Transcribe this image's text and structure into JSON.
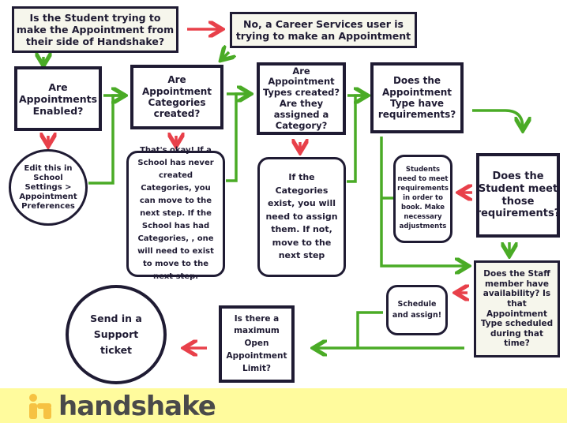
{
  "nodes": {
    "student_side": "Is the Student trying to make the Appointment from their side of Handshake?",
    "career_services": "No, a Career Services user is trying to make an Appointment",
    "appointments_enabled": "Are Appointments Enabled?",
    "edit_settings": "Edit this in School Settings > Appointment Preferences",
    "categories_created": "Are Appointment Categories created?",
    "categories_okay": "That's okay! If a School has never created Categories, you can move to the next step. If the School has had Categories, , one will need to exist to move to the next step.",
    "types_created": "Are Appointment Types created? Are they assigned a Category?",
    "assign_types": "If the Categories exist, you will need to assign them. If not, move to the next step",
    "type_requirements": "Does the Appointment Type have requirements?",
    "students_need": "Students need to meet requirements in order to book. Make necessary adjustments",
    "student_meet": "Does the Student meet those requirements?",
    "staff_availability": "Does the Staff member have availability? Is that Appointment Type scheduled during that time?",
    "schedule_assign": "Schedule and assign!",
    "max_limit": "Is there a maximum Open Appointment Limit?",
    "support_ticket": "Send in a Support ticket"
  },
  "footer": {
    "logo": "handshake"
  },
  "colors": {
    "yes_arrow": "#4aab26",
    "no_arrow": "#e8404a",
    "border": "#1f1b33",
    "footer_bg": "#fffb9d",
    "logo_icon": "#f6c242"
  }
}
